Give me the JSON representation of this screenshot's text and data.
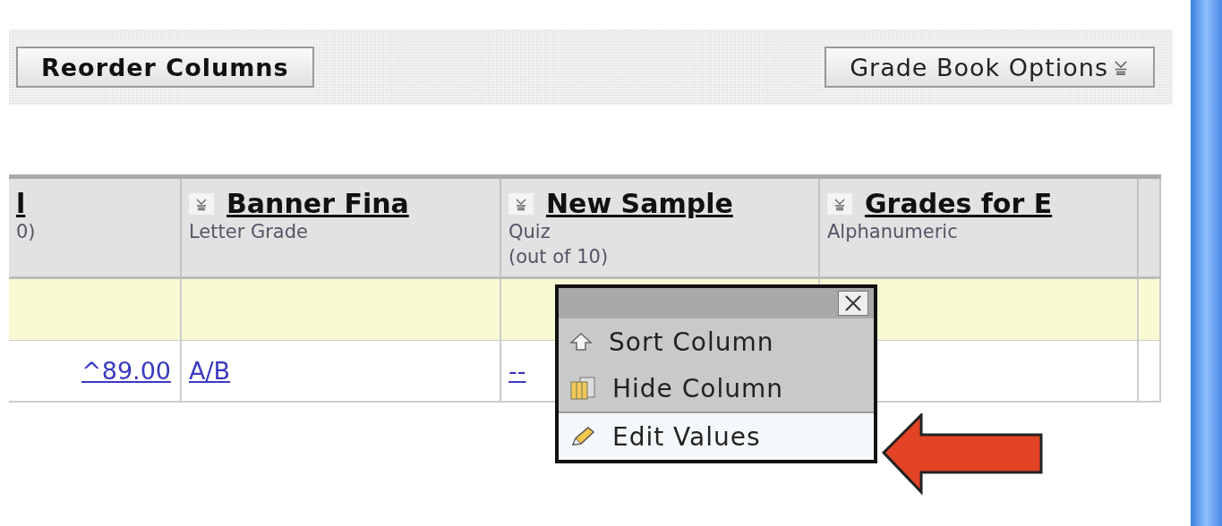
{
  "toolbar": {
    "buttons": [
      {
        "label": "Reorder Columns",
        "kind": "plain"
      },
      {
        "label": "Grade Book Options",
        "kind": "dropdown"
      }
    ]
  },
  "grade_table": {
    "columns": [
      {
        "title": "l",
        "details": [
          "0)"
        ],
        "menu": false
      },
      {
        "title": "Banner Fina",
        "details": [
          "Letter Grade"
        ],
        "menu": true
      },
      {
        "title": "New Sample",
        "details": [
          "Quiz",
          "(out of 10)"
        ],
        "menu": true
      },
      {
        "title": "Grades for E",
        "details": [
          "Alphanumeric"
        ],
        "menu": true
      }
    ],
    "rows": [
      {
        "kind": "highlight",
        "cells": []
      },
      {
        "kind": "grades",
        "cells": [
          "^89.00",
          "A/B",
          "--"
        ]
      }
    ]
  },
  "column_menu": {
    "items": [
      {
        "label": "Sort Column",
        "kind": "sort",
        "selected": false
      },
      {
        "label": "Hide Column",
        "kind": "hide",
        "selected": false
      },
      {
        "label": "Edit Values",
        "kind": "edit",
        "selected": true
      }
    ]
  }
}
